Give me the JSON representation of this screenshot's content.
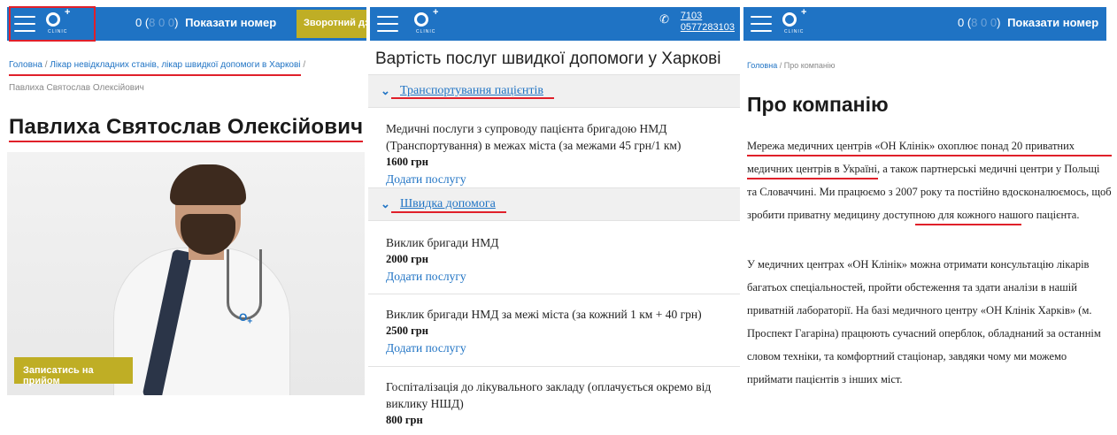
{
  "doctor_page": {
    "header": {
      "phone_prefix": "0 (",
      "phone_dim": "8 0 0",
      "phone_suffix": ")",
      "show_number": "Показати номер",
      "callback_label": "Зворотний дзвінок"
    },
    "logo_sub": "CLINIC",
    "breadcrumb": {
      "home": "Головна",
      "sep": "/",
      "category": "Лікар невідкладних станів, лікар швидкої допомоги в Харкові",
      "current": "Павлиха Святослав Олексійович"
    },
    "doctor_name": "Павлиха Святослав Олексійович",
    "appointment_button": "Записатись на прийом",
    "photo_logo": "O↔"
  },
  "prices_page": {
    "header": {
      "phones": [
        "7103",
        "0577283103"
      ],
      "phone_icon": "phone-icon"
    },
    "title": "Вартість послуг швидкої допомоги у Харкові",
    "sections": [
      {
        "label": "Транспортування пацієнтів",
        "services": [
          {
            "name": "Медичні послуги з супроводу пацієнта бригадою НМД (Транспортування) в межах міста (за межами 45 грн/1 км)",
            "price": "1600 грн",
            "add": "Додати послугу"
          }
        ]
      },
      {
        "label": "Швидка допомога",
        "services": [
          {
            "name": "Виклик бригади НМД",
            "price": "2000 грн",
            "add": "Додати послугу"
          },
          {
            "name": "Виклик бригади НМД за межі міста (за кожний 1 км + 40 грн)",
            "price": "2500 грн",
            "add": "Додати послугу"
          },
          {
            "name": "Госпіталізація до лікувального закладу (оплачується окремо від виклику НШД)",
            "price": "800 грн",
            "add": ""
          }
        ]
      }
    ]
  },
  "about_page": {
    "header": {
      "phone_prefix": "0 (",
      "phone_dim": "8 0 0",
      "phone_suffix": ")",
      "show_number": "Показати номер"
    },
    "breadcrumb": {
      "home": "Головна",
      "sep": "/",
      "current": "Про компанію"
    },
    "title": "Про компанію",
    "paragraph1": "Мережа медичних центрів «ОН Клінік» охоплює понад 20 приватних медичних центрів в Україні, а також партнерські медичні центри у Польщі та Словаччині. Ми працюємо з 2007 року та постійно вдосконалюємось, щоб зробити приватну медицину доступною для кожного нашого пацієнта.",
    "paragraph2": "У медичних центрах «ОН Клінік» можна отримати консультацію лікарів багатьох спеціальностей, пройти обстеження та здати аналізи в нашій приватній лабораторії. На базі медичного центру «ОН Клінік Харків» (м. Проспект Гагаріна) працюють сучасний оперблок, обладнаний за останнім словом техніки, та комфортний стаціонар, завдяки чому ми можемо приймати пацієнтів з інших міст."
  },
  "colors": {
    "header_blue": "#1f73c4",
    "button_gold": "#bfae25",
    "annotation_red": "#e0202a"
  }
}
